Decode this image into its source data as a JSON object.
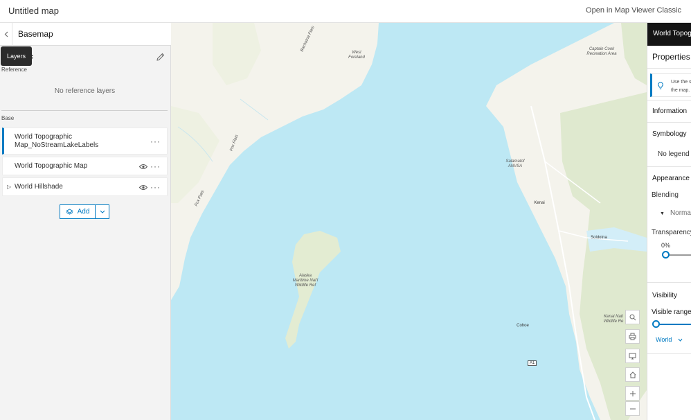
{
  "header": {
    "title": "Untitled map",
    "classic_link": "Open in Map Viewer Classic"
  },
  "left_panel": {
    "title": "Basemap",
    "back_icon": "chevron-left-icon",
    "basemap_name_visible": "hic",
    "tooltip": "Layers",
    "reference_label": "Reference",
    "no_reference": "No reference layers",
    "base_label": "Base",
    "layers": [
      {
        "name_line1": "World Topographic",
        "name_line2": "Map_NoStreamLakeLabels"
      },
      {
        "name": "World Topographic Map"
      },
      {
        "name": "World Hillshade"
      }
    ],
    "more_glyph": "···",
    "caret_glyph": "▷",
    "add_label": "Add"
  },
  "map": {
    "labels": {
      "bachatna": "Bachatna Flats",
      "west_foreland_1": "West",
      "west_foreland_2": "Foreland",
      "fox1": "Fox Flats",
      "fox2": "Fox Flats",
      "captain_cook_1": "Captain Cook",
      "captain_cook_2": "Recreation Area",
      "salamatof_1": "Salamatof",
      "salamatof_2": "ANVSA",
      "kenai": "Kenai",
      "soldotna": "Soldotna",
      "alaska_1": "Alaska",
      "alaska_2": "Maritime Nat'l",
      "alaska_3": "Wildlife Ref",
      "cohoe": "Cohoe",
      "kenai_nat_1": "Kenai Nati",
      "kenai_nat_2": "Wildlife Re",
      "highway": "A1"
    },
    "colors": {
      "water": "#bde8f4",
      "land": "#f4f3ec",
      "park": "#dfe9cf"
    }
  },
  "right_panel": {
    "header": "World Topogr",
    "properties": "Properties",
    "tip_line1": "Use the s",
    "tip_line2": "the map.",
    "information": "Information",
    "symbology": "Symbology",
    "no_legend": "No legend",
    "appearance": "Appearance",
    "blending": "Blending",
    "blend_value": "Norma",
    "transparency": "Transparency",
    "transparency_value": "0%",
    "visibility": "Visibility",
    "visible_range": "Visible range",
    "world": "World"
  }
}
